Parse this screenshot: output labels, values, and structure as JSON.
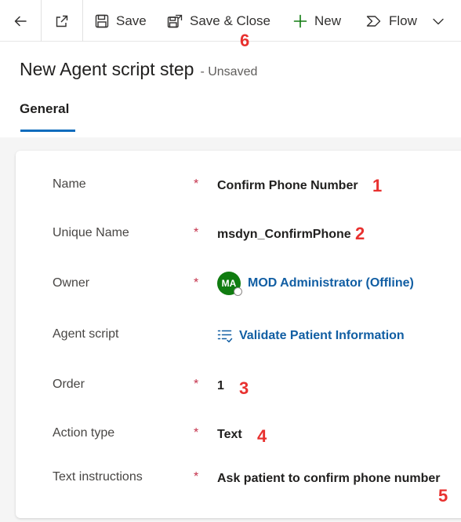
{
  "toolbar": {
    "back_icon": "back-arrow-icon",
    "popout_icon": "pop-out-icon",
    "save_label": "Save",
    "save_close_label": "Save & Close",
    "new_label": "New",
    "flow_label": "Flow",
    "more_icon": "chevron-down-icon"
  },
  "header": {
    "title": "New Agent script step",
    "status": "- Unsaved",
    "tabs": [
      {
        "label": "General"
      }
    ]
  },
  "form": {
    "name": {
      "label": "Name",
      "required": "*",
      "value": "Confirm Phone Number"
    },
    "unique_name": {
      "label": "Unique Name",
      "required": "*",
      "value": "msdyn_ConfirmPhone"
    },
    "owner": {
      "label": "Owner",
      "required": "*",
      "initials": "MA",
      "value": "MOD Administrator (Offline)"
    },
    "agent_script": {
      "label": "Agent script",
      "value": "Validate Patient Information"
    },
    "order": {
      "label": "Order",
      "required": "*",
      "value": "1"
    },
    "action_type": {
      "label": "Action type",
      "required": "*",
      "value": "Text"
    },
    "text_instructions": {
      "label": "Text instructions",
      "required": "*",
      "value": "Ask patient to confirm phone number"
    }
  },
  "annotations": {
    "a1": "1",
    "a2": "2",
    "a3": "3",
    "a4": "4",
    "a5": "5",
    "a6": "6"
  },
  "colors": {
    "accent": "#0f6cbd",
    "link": "#115ea3",
    "required": "#c4314b",
    "annotation": "#e8312f",
    "avatar": "#107c10"
  }
}
